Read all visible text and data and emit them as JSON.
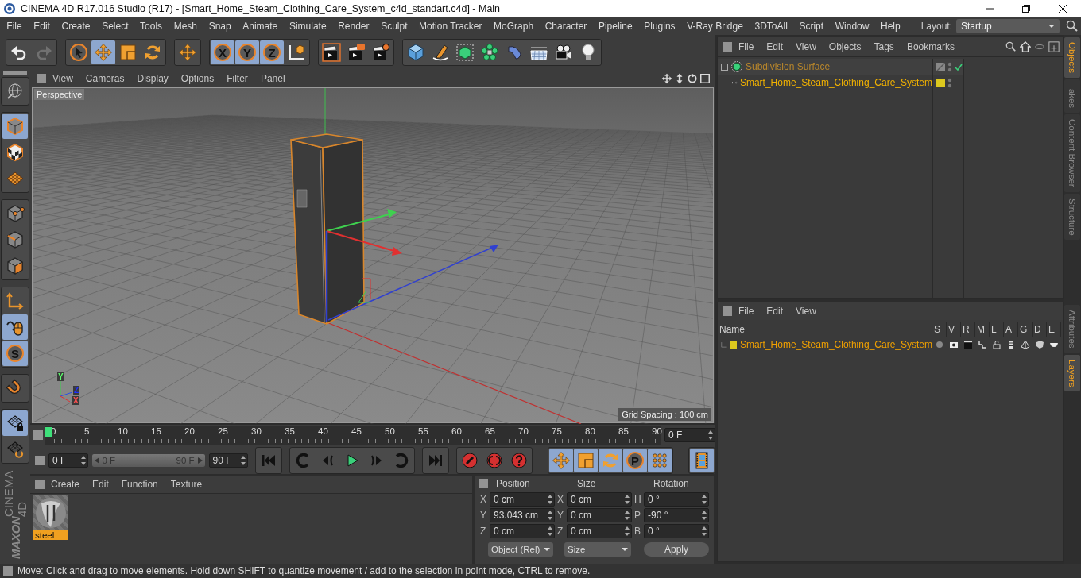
{
  "window": {
    "title": "CINEMA 4D R17.016 Studio (R17) - [Smart_Home_Steam_Clothing_Care_System_c4d_standart.c4d] - Main"
  },
  "menu": [
    "File",
    "Edit",
    "Create",
    "Select",
    "Tools",
    "Mesh",
    "Snap",
    "Animate",
    "Simulate",
    "Render",
    "Sculpt",
    "Motion Tracker",
    "MoGraph",
    "Character",
    "Pipeline",
    "Plugins",
    "V-Ray Bridge",
    "3DToAll",
    "Script",
    "Window",
    "Help"
  ],
  "layout": {
    "label": "Layout:",
    "value": "Startup"
  },
  "toolbar": [
    {
      "items": [
        {
          "kind": "undo",
          "selected": false,
          "disabled": false
        },
        {
          "kind": "redo",
          "selected": false,
          "disabled": true
        }
      ]
    },
    {
      "items": [
        {
          "kind": "select",
          "selected": false
        },
        {
          "kind": "move",
          "selected": true
        },
        {
          "kind": "scale",
          "selected": false
        },
        {
          "kind": "rotate",
          "selected": false
        }
      ]
    },
    {
      "items": [
        {
          "kind": "move",
          "selected": false
        }
      ]
    },
    {
      "items": [
        {
          "kind": "axis",
          "label": "X",
          "selected": true
        },
        {
          "kind": "axis",
          "label": "Y",
          "selected": true
        },
        {
          "kind": "axis",
          "label": "Z",
          "selected": true
        },
        {
          "kind": "coords",
          "selected": false
        }
      ]
    },
    {
      "items": [
        {
          "kind": "render_view",
          "selected": false
        },
        {
          "kind": "render_pv",
          "selected": false
        },
        {
          "kind": "render_settings",
          "selected": false
        }
      ]
    },
    {
      "items": [
        {
          "kind": "cube",
          "selected": false
        },
        {
          "kind": "pen",
          "selected": false
        },
        {
          "kind": "subdiv",
          "selected": false
        },
        {
          "kind": "cloner",
          "selected": false
        },
        {
          "kind": "deformer",
          "selected": false
        },
        {
          "kind": "floor",
          "selected": false
        },
        {
          "kind": "camera",
          "selected": false
        },
        {
          "kind": "light",
          "selected": false
        }
      ]
    }
  ],
  "left_tools": [
    {
      "items": [
        {
          "kind": "globe",
          "selected": false
        }
      ]
    },
    {
      "items": [
        {
          "kind": "model",
          "selected": true
        },
        {
          "kind": "texture",
          "selected": false
        },
        {
          "kind": "workplane",
          "selected": false
        }
      ]
    },
    {
      "items": [
        {
          "kind": "points",
          "selected": false
        },
        {
          "kind": "edges",
          "selected": false
        },
        {
          "kind": "polygons",
          "selected": false
        }
      ]
    },
    {
      "items": [
        {
          "kind": "axis_mode",
          "selected": false
        },
        {
          "kind": "tweak",
          "selected": true
        },
        {
          "kind": "snap",
          "label": "S",
          "selected": true
        }
      ]
    },
    {
      "items": [
        {
          "kind": "magnet",
          "selected": false
        }
      ]
    },
    {
      "items": [
        {
          "kind": "lock_plane",
          "selected": true
        },
        {
          "kind": "align_plane",
          "selected": false
        }
      ]
    }
  ],
  "brand": {
    "maker": "MAXON",
    "product": "CINEMA 4D"
  },
  "viewport": {
    "menu": [
      "View",
      "Cameras",
      "Display",
      "Options",
      "Filter",
      "Panel"
    ],
    "camera": "Perspective",
    "grid_spacing": "Grid Spacing : 100 cm",
    "axis_labels": [
      "Y",
      "Z",
      "X"
    ]
  },
  "timeline": {
    "ticks": [
      "0",
      "5",
      "10",
      "15",
      "20",
      "25",
      "30",
      "35",
      "40",
      "45",
      "50",
      "55",
      "60",
      "65",
      "70",
      "75",
      "80",
      "85",
      "90"
    ],
    "current": "0 F",
    "start": "0 F",
    "slider": {
      "level": 1,
      "start": "0 F",
      "end": "90 F"
    },
    "end": "90 F",
    "transport": [
      {
        "items": [
          {
            "kind": "first",
            "selected": false
          }
        ]
      },
      {
        "items": [
          {
            "kind": "prevkey",
            "selected": false
          },
          {
            "kind": "prevframe",
            "selected": false
          },
          {
            "kind": "play",
            "selected": false
          },
          {
            "kind": "nextframe",
            "selected": false
          },
          {
            "kind": "nextkey",
            "selected": false
          }
        ]
      },
      {
        "items": [
          {
            "kind": "last",
            "selected": false
          }
        ]
      },
      {
        "items": [
          {
            "kind": "record",
            "selected": false
          },
          {
            "kind": "autokey",
            "selected": false
          },
          {
            "kind": "keysel",
            "selected": false
          }
        ]
      },
      {
        "items": [
          {
            "kind": "move",
            "selected": true
          },
          {
            "kind": "scale",
            "selected": true
          },
          {
            "kind": "rotate",
            "selected": true
          },
          {
            "kind": "param",
            "label": "P",
            "selected": true
          },
          {
            "kind": "pla",
            "selected": true
          }
        ]
      },
      {
        "items": [
          {
            "kind": "filmstrip",
            "selected": true
          }
        ]
      }
    ]
  },
  "materials": {
    "menu": [
      "Create",
      "Edit",
      "Function",
      "Texture"
    ],
    "items": [
      {
        "name": "steel",
        "selected": true
      }
    ]
  },
  "coordinates": {
    "headers": [
      "Position",
      "Size",
      "Rotation"
    ],
    "rows": [
      [
        {
          "axis": "X",
          "value": "0 cm"
        },
        {
          "axis": "X",
          "value": "0 cm"
        },
        {
          "axis": "H",
          "value": "0 °"
        }
      ],
      [
        {
          "axis": "Y",
          "value": "93.043 cm"
        },
        {
          "axis": "Y",
          "value": "0 cm"
        },
        {
          "axis": "P",
          "value": "-90 °"
        }
      ],
      [
        {
          "axis": "Z",
          "value": "0 cm"
        },
        {
          "axis": "Z",
          "value": "0 cm"
        },
        {
          "axis": "B",
          "value": "0 °"
        }
      ]
    ],
    "mode": "Object (Rel)",
    "size_mode": "Size",
    "apply": "Apply"
  },
  "objects": {
    "menu": [
      "File",
      "Edit",
      "View",
      "Objects",
      "Tags",
      "Bookmarks"
    ],
    "tree": [
      {
        "name": "Subdivision Surface",
        "kind": "subdivision",
        "expanded": true,
        "selected": false,
        "enabled": true,
        "children": [
          {
            "name": "Smart_Home_Steam_Clothing_Care_System",
            "kind": "null",
            "expanded": false,
            "selected": true,
            "enabled": false,
            "color": "#dcc81e"
          }
        ]
      }
    ]
  },
  "layers": {
    "menu": [
      "File",
      "Edit",
      "View"
    ],
    "columns": [
      "Name",
      "S",
      "V",
      "R",
      "M",
      "L",
      "A",
      "G",
      "D",
      "E"
    ],
    "rows": [
      {
        "name": "Smart_Home_Steam_Clothing_Care_System",
        "color": "#dcc81e"
      }
    ]
  },
  "side_tabs": {
    "top": [
      {
        "label": "Objects",
        "selected": true
      },
      {
        "label": "Takes",
        "selected": false
      },
      {
        "label": "Content Browser",
        "selected": false
      },
      {
        "label": "Structure",
        "selected": false
      }
    ],
    "bottom": [
      {
        "label": "Attributes",
        "selected": false
      },
      {
        "label": "Layers",
        "selected": true
      }
    ]
  },
  "status": "Move: Click and drag to move elements. Hold down SHIFT to quantize movement / add to the selection in point mode, CTRL to remove."
}
